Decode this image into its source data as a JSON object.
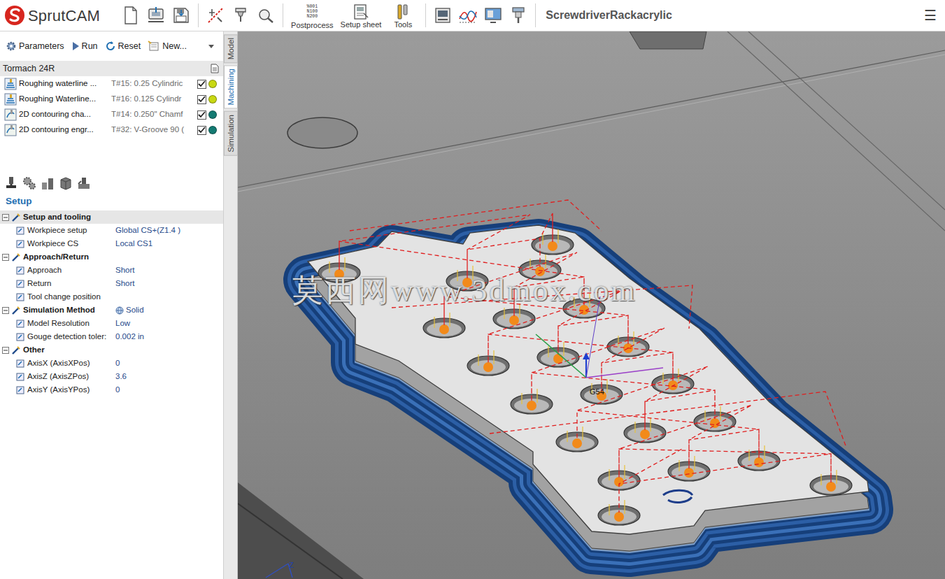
{
  "app": {
    "name": "SprutCAM",
    "project": "ScrewdriverRackacrylic",
    "menu": "☰"
  },
  "toolbar": {
    "postprocess": {
      "label": "Postprocess",
      "icon_text": [
        "%001",
        "N100",
        "N200"
      ]
    },
    "setup_sheet": {
      "label": "Setup sheet"
    },
    "tools": {
      "label": "Tools"
    }
  },
  "panel_toolbar": [
    {
      "label": "Parameters"
    },
    {
      "label": "Run"
    },
    {
      "label": "Reset"
    },
    {
      "label": "New..."
    }
  ],
  "tree": {
    "root": "Tormach 24R",
    "operations": [
      {
        "kind": "roughing",
        "name": "Roughing waterline ...",
        "tool": "T#15: 0.25 Cylindric",
        "checked": true,
        "color": "#c8d812"
      },
      {
        "kind": "roughing",
        "name": "Roughing Waterline...",
        "tool": "T#16: 0.125 Cylindr",
        "checked": true,
        "color": "#c8d812"
      },
      {
        "kind": "contouring",
        "name": "2D contouring cha...",
        "tool": "T#14: 0.250\" Chamf",
        "checked": true,
        "color": "#137a72"
      },
      {
        "kind": "contouring",
        "name": "2D contouring engr...",
        "tool": "T#32: V-Groove 90 (",
        "checked": true,
        "color": "#137a72"
      }
    ]
  },
  "side_tabs": [
    {
      "label": "Model",
      "selected": false
    },
    {
      "label": "Machining",
      "selected": true
    },
    {
      "label": "Simulation",
      "selected": false
    }
  ],
  "inspector": {
    "title": "Setup",
    "groups": [
      {
        "title": "Setup and tooling",
        "expanded": true,
        "selected": true,
        "items": [
          {
            "label": "Workpiece setup",
            "value": "Global CS+(Z1.4 )"
          },
          {
            "label": "Workpiece CS",
            "value": "Local CS1"
          }
        ]
      },
      {
        "title": "Approach/Return",
        "expanded": true,
        "selected": false,
        "items": [
          {
            "label": "Approach",
            "value": "Short"
          },
          {
            "label": "Return",
            "value": "Short"
          },
          {
            "label": "Tool change position"
          }
        ]
      },
      {
        "title": "Simulation Method",
        "value": "Solid",
        "expanded": true,
        "selected": false,
        "items": [
          {
            "label": "Model Resolution",
            "value": "Low"
          },
          {
            "label": "Gouge detection toler:",
            "value": "0.002 in"
          }
        ]
      },
      {
        "title": "Other",
        "expanded": true,
        "selected": false,
        "items": [
          {
            "label": "AxisX (AxisXPos)",
            "value": "0"
          },
          {
            "label": "AxisZ (AxisZPos)",
            "value": "3.6"
          },
          {
            "label": "AxisY (AxisYPos)",
            "value": "0"
          }
        ]
      }
    ]
  },
  "viewport": {
    "watermark": "莫西网www.3dmox.com",
    "cs_label": "G54",
    "axis_label": "Z"
  }
}
